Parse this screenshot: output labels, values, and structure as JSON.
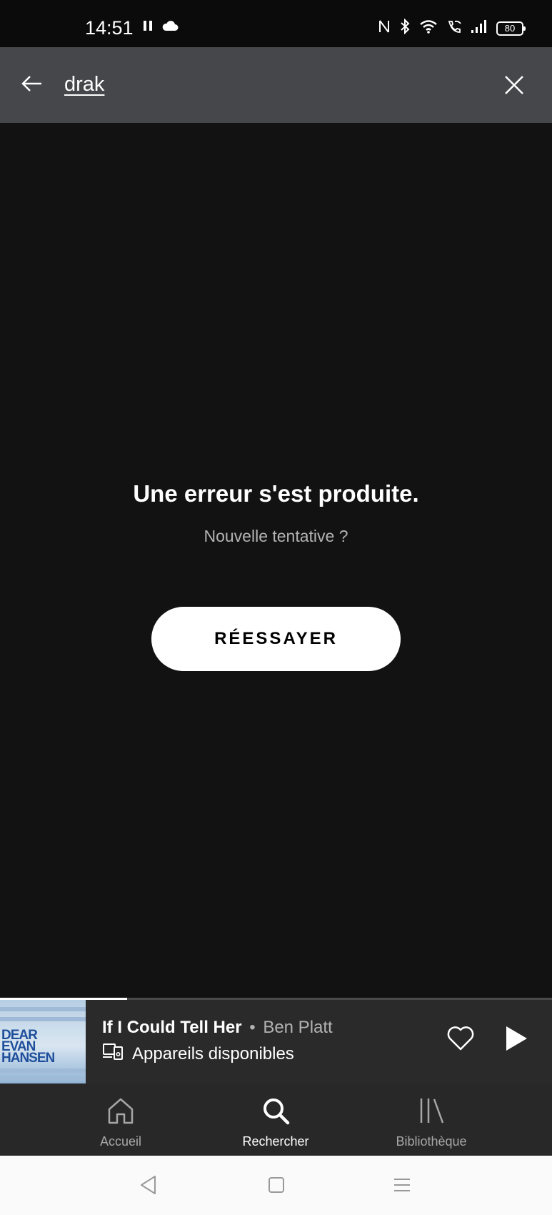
{
  "status_bar": {
    "time": "14:51",
    "battery": "80",
    "icons": [
      "pause-icon",
      "cloud-icon",
      "nfc-icon",
      "bluetooth-icon",
      "wifi-icon",
      "wifi-call-icon",
      "signal-icon",
      "battery-icon"
    ]
  },
  "search": {
    "query": "drak",
    "back_icon": "back-arrow-icon",
    "clear_icon": "close-icon"
  },
  "error": {
    "title": "Une erreur s'est produite.",
    "subtitle": "Nouvelle tentative ?",
    "retry_label": "RÉESSAYER"
  },
  "now_playing": {
    "title": "If I Could Tell Her",
    "separator": "•",
    "artist": "Ben Platt",
    "devices_label": "Appareils disponibles",
    "album_art_text": [
      "DEAR",
      "EVAN",
      "HANSEN"
    ],
    "progress_fraction": 0.23
  },
  "bottom_nav": {
    "items": [
      {
        "label": "Accueil",
        "icon": "home-icon",
        "active": false
      },
      {
        "label": "Rechercher",
        "icon": "search-icon",
        "active": true
      },
      {
        "label": "Bibliothèque",
        "icon": "library-icon",
        "active": false
      }
    ]
  },
  "colors": {
    "background": "#121212",
    "header": "#45474a",
    "mini_player": "#2a2a2a",
    "nav": "#282828",
    "secondary_text": "#b3b3b3"
  }
}
